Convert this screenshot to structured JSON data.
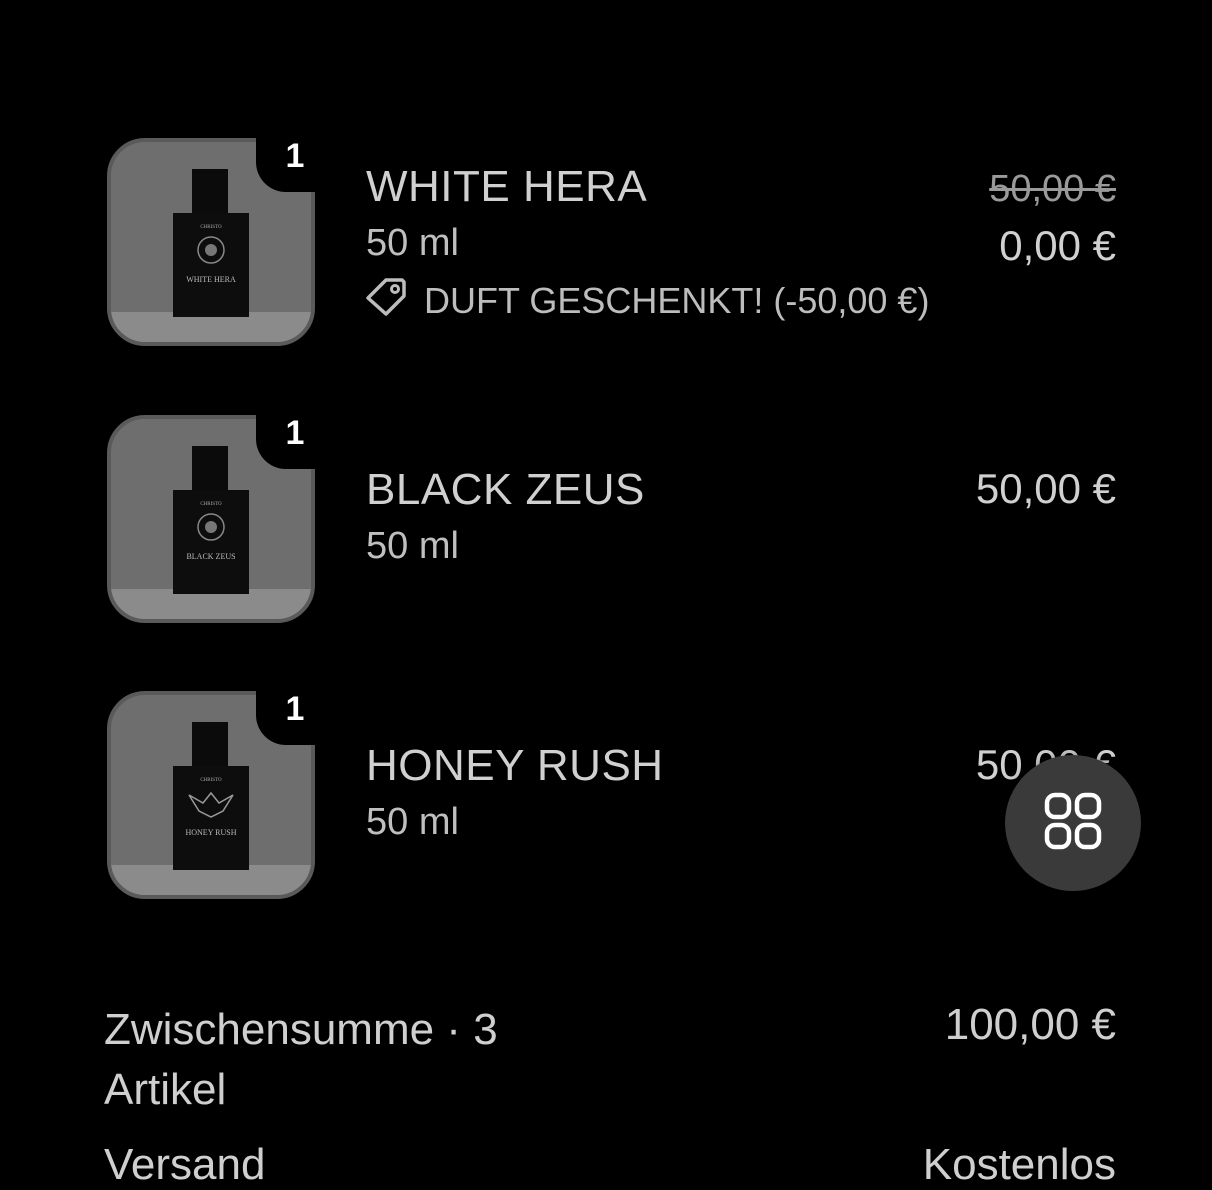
{
  "cart": {
    "items": [
      {
        "name": "WHITE HERA",
        "size": "50 ml",
        "quantity": "1",
        "original_price": "50,00 €",
        "price": "0,00 €",
        "discount_label": "DUFT GESCHENKT! (-50,00 €)",
        "bottle_brand": "CHRISTO",
        "bottle_label": "WHITE HERA"
      },
      {
        "name": "BLACK ZEUS",
        "size": "50 ml",
        "quantity": "1",
        "price": "50,00 €",
        "bottle_brand": "CHRISTO",
        "bottle_label": "BLACK ZEUS"
      },
      {
        "name": "HONEY RUSH",
        "size": "50 ml",
        "quantity": "1",
        "price": "50,00 €",
        "bottle_brand": "CHRISTO",
        "bottle_label": "HONEY RUSH"
      }
    ]
  },
  "summary": {
    "subtotal_label": "Zwischensumme · 3 Artikel",
    "subtotal_value": "100,00 €",
    "shipping_label": "Versand",
    "shipping_value": "Kostenlos"
  },
  "icons": {
    "discount": "tag-icon",
    "fab": "grid-icon"
  }
}
